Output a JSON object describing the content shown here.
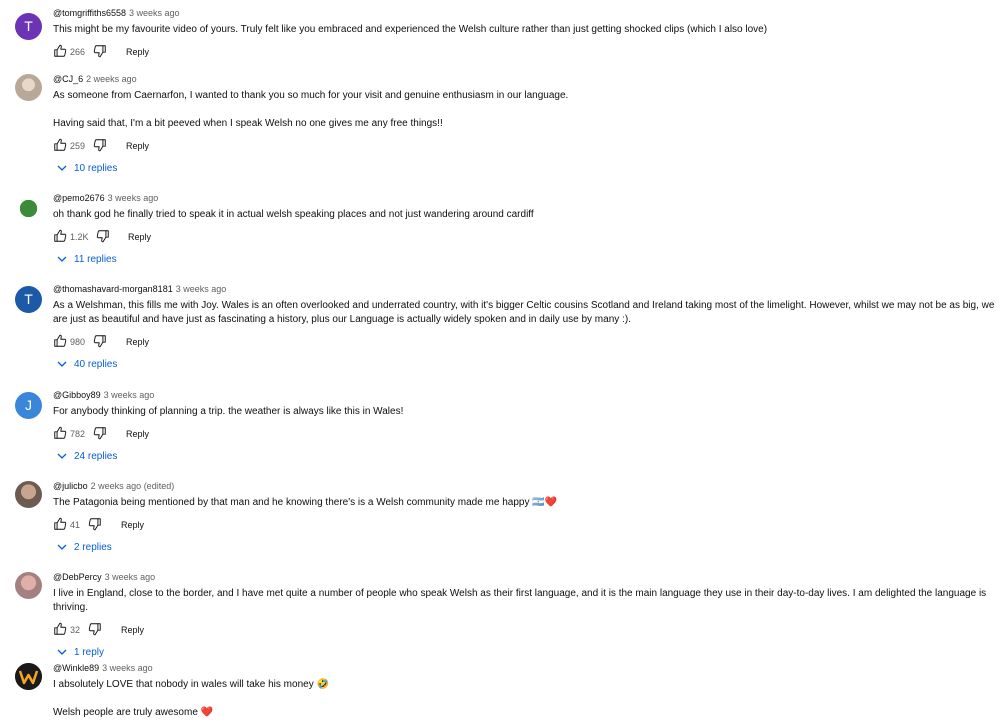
{
  "comments": [
    {
      "author": "@tomgriffiths6558",
      "time": "3 weeks ago",
      "initial": "T",
      "avatar_color": "#6c33b5",
      "paragraphs": [
        "This might be my favourite video of yours. Truly felt like you embraced and experienced the Welsh culture rather than just getting shocked clips (which I also love)"
      ],
      "likes": "266",
      "reply_label": "Reply",
      "replies": ""
    },
    {
      "author": "@CJ_6",
      "time": "2 weeks ago",
      "initial": "",
      "avatar_color": "",
      "paragraphs": [
        "As someone from Caernarfon, I wanted to thank you so much for your visit and genuine enthusiasm in our language.",
        "Having said that, I'm a bit peeved when I speak Welsh no one gives me any free things!!"
      ],
      "likes": "259",
      "reply_label": "Reply",
      "replies": "10 replies"
    },
    {
      "author": "@pemo2676",
      "time": "3 weeks ago",
      "initial": "",
      "avatar_color": "",
      "paragraphs": [
        "oh thank god he finally tried to speak it in actual welsh speaking places and not just wandering around cardiff"
      ],
      "likes": "1.2K",
      "reply_label": "Reply",
      "replies": "11 replies"
    },
    {
      "author": "@thomashavard-morgan8181",
      "time": "3 weeks ago",
      "initial": "T",
      "avatar_color": "#1c5aa8",
      "paragraphs": [
        "As a Welshman, this fills me with Joy. Wales is an often overlooked and underrated country, with it's bigger Celtic cousins Scotland and Ireland taking most of the limelight. However, whilst we may not be as big, we are just as beautiful and have just as fascinating a history, plus our Language is actually widely spoken and in daily use by many :)."
      ],
      "likes": "980",
      "reply_label": "Reply",
      "replies": "40 replies"
    },
    {
      "author": "@Gibboy89",
      "time": "3 weeks ago",
      "initial": "J",
      "avatar_color": "#3a86d9",
      "paragraphs": [
        "For anybody thinking of planning a trip. the weather is always like this in Wales!"
      ],
      "likes": "782",
      "reply_label": "Reply",
      "replies": "24 replies"
    },
    {
      "author": "@julicbo",
      "time": "2 weeks ago (edited)",
      "initial": "",
      "avatar_color": "",
      "paragraphs": [
        "The Patagonia being mentioned by that man and he knowing there's is a Welsh community made me happy 🇦🇷❤️"
      ],
      "likes": "41",
      "reply_label": "Reply",
      "replies": "2 replies"
    },
    {
      "author": "@DebPercy",
      "time": "3 weeks ago",
      "initial": "",
      "avatar_color": "",
      "paragraphs": [
        "I live in England, close to the border, and I have met quite a number of people who speak Welsh as their first language, and it is the main language they use in their day-to-day lives. I am delighted the language is thriving."
      ],
      "likes": "32",
      "reply_label": "Reply",
      "replies": "1 reply"
    },
    {
      "author": "@Winkle89",
      "time": "3 weeks ago",
      "initial": "",
      "avatar_color": "",
      "paragraphs": [
        "I absolutely LOVE that nobody in wales will take his money 🤣",
        "Welsh people are truly awesome ❤️"
      ],
      "likes": "",
      "reply_label": "",
      "replies": ""
    }
  ],
  "icons": {
    "like": "thumb-up-icon",
    "dislike": "thumb-down-icon",
    "expand": "chevron-down-icon"
  },
  "colors": {
    "link": "#065fd4",
    "meta": "#606060"
  }
}
